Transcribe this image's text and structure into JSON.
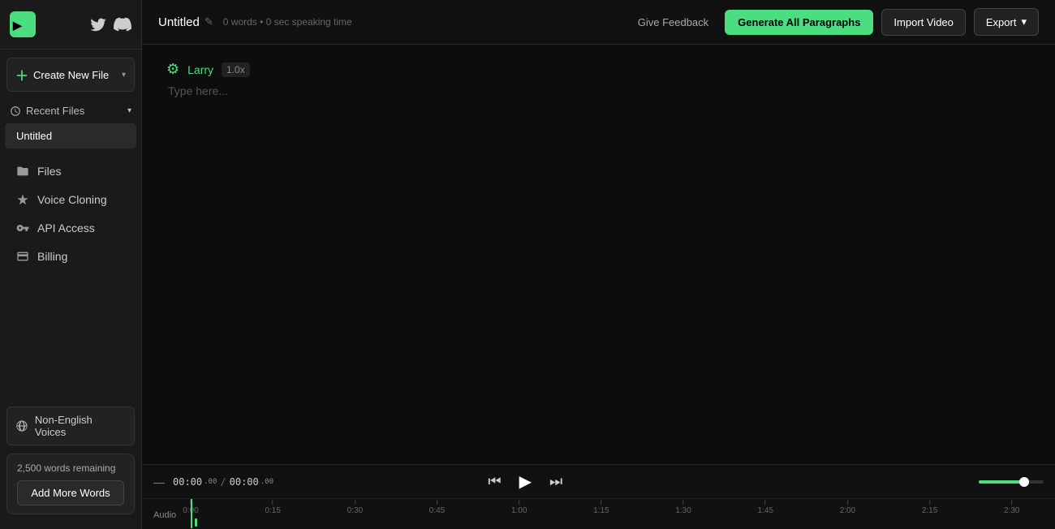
{
  "app": {
    "logo_text": "PLAYHT",
    "twitter_icon": "twitter",
    "discord_icon": "discord"
  },
  "sidebar": {
    "create_button_label": "Create New File",
    "recent_files_label": "Recent Files",
    "recent_files": [
      {
        "name": "Untitled"
      }
    ],
    "nav_items": [
      {
        "id": "files",
        "label": "Files",
        "icon": "folder"
      },
      {
        "id": "voice-cloning",
        "label": "Voice Cloning",
        "icon": "stars"
      },
      {
        "id": "api-access",
        "label": "API Access",
        "icon": "key"
      },
      {
        "id": "billing",
        "label": "Billing",
        "icon": "card"
      }
    ],
    "non_english_label": "Non-English Voices",
    "words_remaining": "2,500 words remaining",
    "add_words_label": "Add More Words"
  },
  "topbar": {
    "file_title": "Untitled",
    "file_meta": "0 words • 0 sec speaking time",
    "give_feedback_label": "Give Feedback",
    "generate_label": "Generate All Paragraphs",
    "import_video_label": "Import Video",
    "export_label": "Export"
  },
  "editor": {
    "speaker_name": "Larry",
    "speed": "1.0x",
    "placeholder": "Type here..."
  },
  "timeline": {
    "current_time": "00:00",
    "current_sub": ".00",
    "total_time": "00:00",
    "total_sub": ".00",
    "track_label": "Audio",
    "ruler_marks": [
      "0:00",
      "0:15",
      "0:30",
      "0:45",
      "1:00",
      "1:15",
      "1:30",
      "1:45",
      "2:00",
      "2:15",
      "2:30"
    ]
  }
}
